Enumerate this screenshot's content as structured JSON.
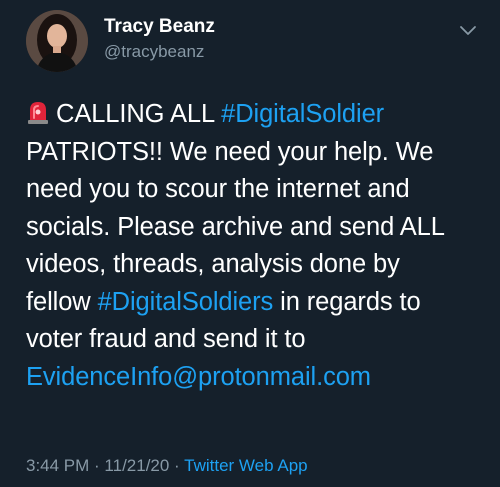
{
  "author": {
    "display_name": "Tracy Beanz",
    "handle": "@tracybeanz",
    "avatar_icon": "profile-photo"
  },
  "menu_icon": "chevron-down-icon",
  "tweet": {
    "emoji_icon": "police-siren-emoji",
    "line1_text": "CALLING ALL ",
    "line1_hashtag": "#DigitalSoldier",
    "line2": "PATRIOTS!! We need your help. We",
    "line3": "need you to scour the internet and",
    "line4": "socials. Please archive and send ALL",
    "line5": "videos, threads, analysis done by",
    "line6_pre": "fellow ",
    "line6_hashtag": "#DigitalSoldiers",
    "line6_post": " in regards to",
    "line7": "voter fraud and send it to",
    "line8_email": "EvidenceInfo@protonmail.com"
  },
  "meta": {
    "timestamp": "3:44 PM · 11/21/20 · ",
    "source_app": "Twitter Web App"
  },
  "colors": {
    "background": "#15202b",
    "link": "#1da1f2",
    "secondary_text": "#8899a6"
  }
}
